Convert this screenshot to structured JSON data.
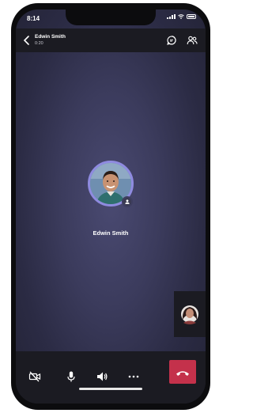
{
  "status_bar": {
    "time": "8:14"
  },
  "call_header": {
    "caller_name": "Edwin Smith",
    "duration": "0:20"
  },
  "participant": {
    "name": "Edwin Smith"
  },
  "icons": {
    "back": "chevron-left-icon",
    "chat": "chat-icon",
    "participants": "people-icon",
    "camera": "camera-off-icon",
    "microphone": "microphone-icon",
    "speaker": "speaker-icon",
    "more": "more-options-icon",
    "hang_up": "hang-up-icon"
  },
  "colors": {
    "end_call": "#c4314b",
    "avatar_ring": "#8f8be0",
    "background": "#3b3b5c",
    "bars": "#1b1b22"
  }
}
